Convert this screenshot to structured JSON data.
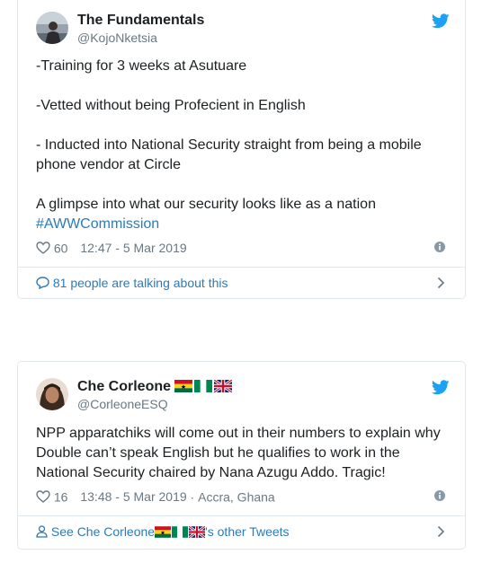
{
  "tweet1": {
    "display_name": "The Fundamentals",
    "handle": "@KojoNketsia",
    "lines": [
      "-Training for 3 weeks at Asutuare",
      "-Vetted without being Profecient in English",
      "- Inducted into National Security straight from being a mobile phone vendor at Circle",
      "A glimpse into what our security looks like as a nation"
    ],
    "hashtag": "#AWWCommission",
    "likes": "60",
    "timestamp": "12:47 - 5 Mar 2019",
    "footer_text": "81 people are talking about this"
  },
  "tweet2": {
    "display_name": "Che Corleone",
    "handle": "@CorleoneESQ",
    "text": "NPP apparatchiks will come out in their numbers to explain why Double can’t speak English but he qualifies to work in the National Security chaired by Nana Azugu Addo. Tragic!",
    "likes": "16",
    "timestamp": "13:48 - 5 Mar 2019",
    "location": "Accra, Ghana",
    "footer_prefix": "See Che Corleone",
    "footer_suffix": "'s other Tweets"
  },
  "colors": {
    "link": "#2b7bb9",
    "twitter_blue": "#1da1f2",
    "muted": "#697882",
    "border": "#e1e8ed"
  },
  "icons": [
    "twitter-bird-icon",
    "heart-icon",
    "info-icon",
    "speech-bubble-icon",
    "person-icon",
    "chevron-right-icon",
    "ghana-flag-icon",
    "nigeria-flag-icon",
    "uk-flag-icon"
  ]
}
